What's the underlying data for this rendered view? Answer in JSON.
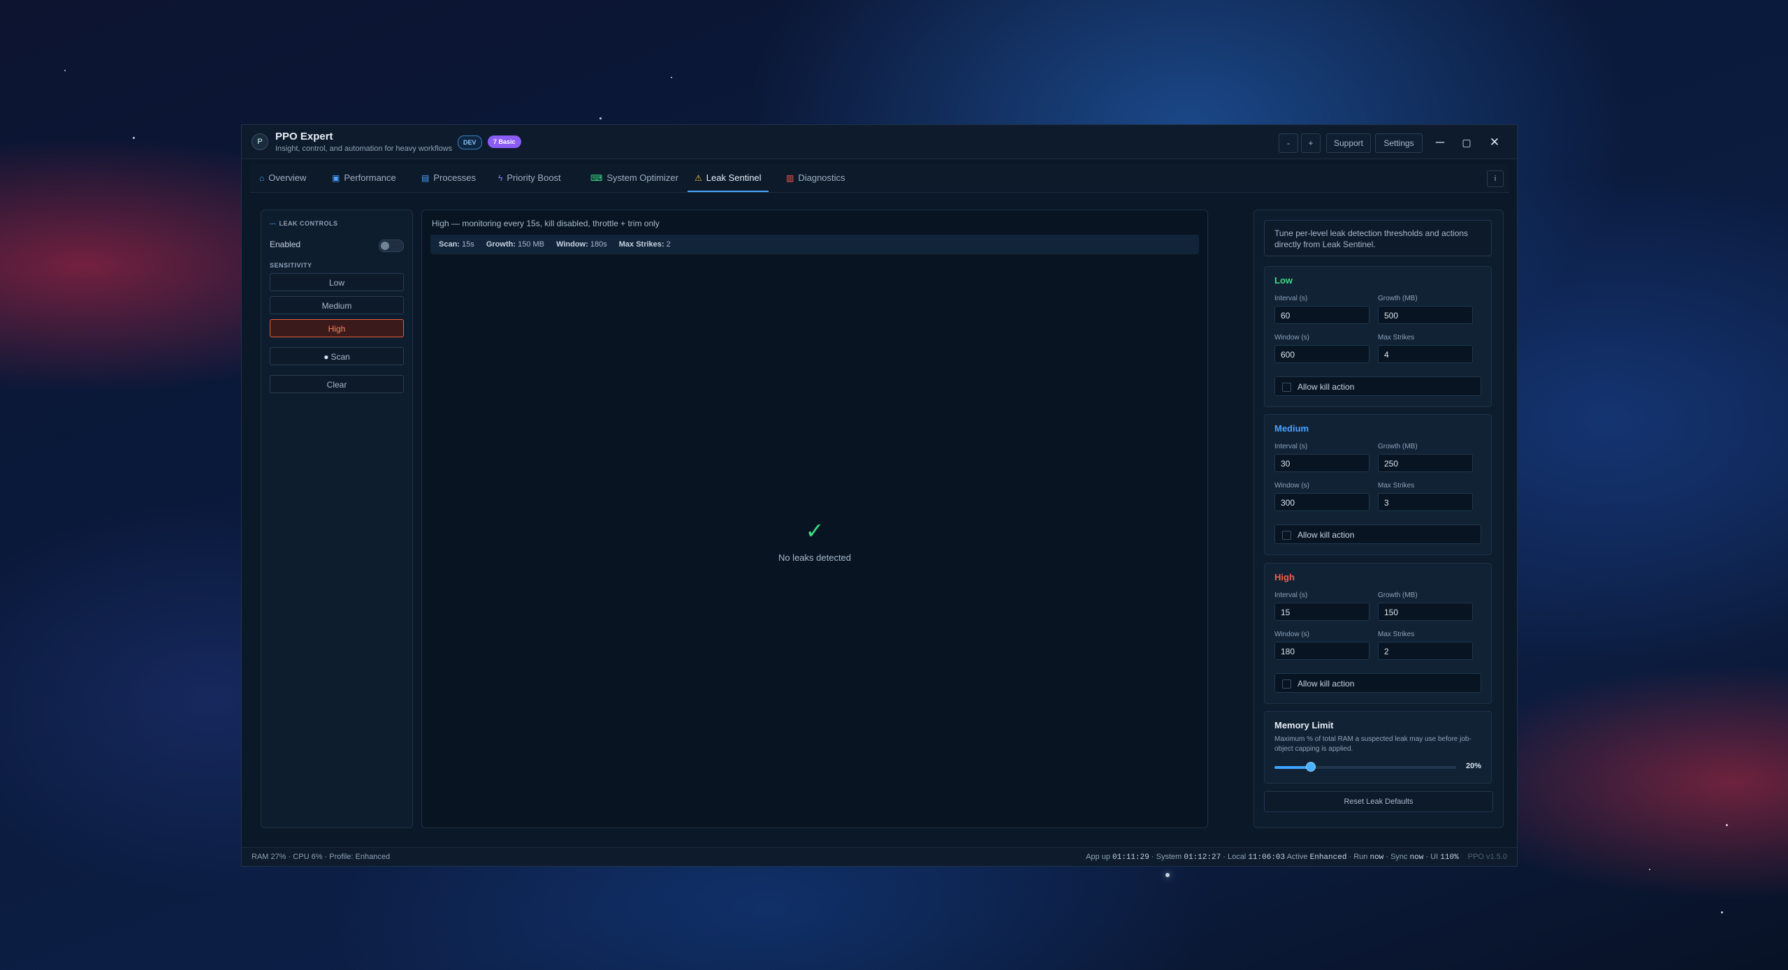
{
  "app": {
    "title": "PPO Expert",
    "subtitle": "Insight, control, and automation for heavy workflows",
    "logo_letter": "P",
    "badge_dev": "DEV",
    "badge_tier": "7 Basic"
  },
  "titlebar": {
    "zoom_out": "-",
    "zoom_in": "+",
    "support": "Support",
    "settings": "Settings",
    "minimize": "─",
    "maximize": "▢",
    "close": "✕"
  },
  "tabs": [
    {
      "label": "Overview",
      "icon": "home-icon",
      "glyph": "⌂"
    },
    {
      "label": "Performance",
      "icon": "chart-icon",
      "glyph": "▣"
    },
    {
      "label": "Processes",
      "icon": "file-icon",
      "glyph": "▤"
    },
    {
      "label": "Priority Boost",
      "icon": "bolt-icon",
      "glyph": "ϟ"
    },
    {
      "label": "System Optimizer",
      "icon": "gamepad-icon",
      "glyph": "⌨"
    },
    {
      "label": "Leak Sentinel",
      "icon": "warning-icon",
      "glyph": "⚠"
    },
    {
      "label": "Diagnostics",
      "icon": "diagnostics-icon",
      "glyph": "▥"
    }
  ],
  "info_button": "i",
  "leak_controls": {
    "title": "LEAK CONTROLS",
    "enabled_label": "Enabled",
    "enabled": false,
    "sensitivity_label": "SENSITIVITY",
    "levels": [
      "Low",
      "Medium",
      "High"
    ],
    "active_level": "High",
    "scan_label": "Scan",
    "clear_label": "Clear"
  },
  "monitor": {
    "status_text": "High — monitoring every 15s, kill disabled, throttle + trim only",
    "scan_label": "Scan:",
    "scan_value": "15s",
    "growth_label": "Growth:",
    "growth_value": "150 MB",
    "window_label": "Window:",
    "window_value": "180s",
    "strikes_label": "Max Strikes:",
    "strikes_value": "2",
    "empty_icon": "✓",
    "empty_text": "No leaks detected"
  },
  "settings_panel": {
    "intro": "Tune per-level leak detection thresholds and actions directly from Leak Sentinel.",
    "field_labels": {
      "interval": "Interval (s)",
      "growth": "Growth (MB)",
      "window": "Window (s)",
      "strikes": "Max Strikes"
    },
    "kill_label": "Allow kill action",
    "levels": [
      {
        "name": "Low",
        "color": "#3ddc84",
        "interval": "60",
        "growth": "500",
        "window": "600",
        "strikes": "4"
      },
      {
        "name": "Medium",
        "color": "#4aa3ff",
        "interval": "30",
        "growth": "250",
        "window": "300",
        "strikes": "3"
      },
      {
        "name": "High",
        "color": "#ff5a4a",
        "interval": "15",
        "growth": "150",
        "window": "180",
        "strikes": "2"
      }
    ],
    "memory_limit": {
      "title": "Memory Limit",
      "description": "Maximum % of total RAM a suspected leak may use before job-object capping is applied.",
      "value_percent": 20,
      "value_label": "20%"
    },
    "reset_label": "Reset Leak Defaults"
  },
  "statusbar": {
    "left": "RAM 27%  ·  CPU 6%  ·  Profile: Enhanced",
    "app_up_label": "App up",
    "app_up": "01:11:29",
    "system_label": "· System",
    "system": "01:12:27",
    "local_label": "· Local",
    "local": "11:06:03",
    "active_label": "Active",
    "active": "Enhanced",
    "run_label": "· Run",
    "run": "now",
    "sync_label": "· Sync",
    "sync": "now",
    "ui_label": "· UI",
    "ui": "110%",
    "version": "PPO v1.5.0"
  }
}
